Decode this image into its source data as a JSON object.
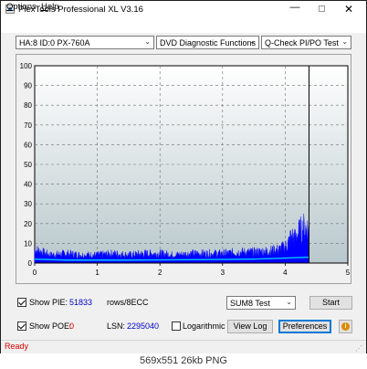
{
  "window": {
    "title": "PlexTools Professional XL V3.16",
    "minimize_glyph": "—",
    "close_glyph": "✕"
  },
  "menu": {
    "options_u": "O",
    "options_rest": "ptions",
    "help_u": "H",
    "help_rest": "elp"
  },
  "toolbar": {
    "drive": "HA:8 ID:0  PX-760A",
    "function": "DVD Diagnostic Functions",
    "test": "Q-Check  PI/PO Test",
    "arrow_glyph": "⌄"
  },
  "chart_data": {
    "type": "area",
    "x_ticks": [
      "0",
      "1",
      "2",
      "3",
      "4",
      "5"
    ],
    "y_ticks": [
      "100",
      "90",
      "80",
      "70",
      "60",
      "50",
      "40",
      "30",
      "20",
      "10",
      "0"
    ],
    "xlim": [
      0,
      5
    ],
    "ylim": [
      0,
      100
    ],
    "grid": true,
    "end_marker_x": 4.38,
    "series": [
      {
        "color": "#0000ff",
        "kind": "pie_bars",
        "x": [
          0,
          0.25,
          0.5,
          0.75,
          1.0,
          1.25,
          1.5,
          1.75,
          2.0,
          2.25,
          2.5,
          2.75,
          3.0,
          3.25,
          3.5,
          3.75,
          3.9,
          4.0,
          4.05,
          4.1,
          4.15,
          4.2,
          4.25,
          4.3,
          4.38
        ],
        "y": [
          10,
          6,
          7,
          6,
          6,
          7,
          6,
          7,
          7,
          6,
          7,
          7,
          7,
          8,
          8,
          9,
          10,
          12,
          15,
          20,
          18,
          22,
          24,
          26,
          25
        ]
      },
      {
        "color": "#00c8ff",
        "kind": "pie_average",
        "x": [
          0,
          0.5,
          1.0,
          1.5,
          2.0,
          2.5,
          3.0,
          3.5,
          4.0,
          4.38
        ],
        "y": [
          2,
          1.5,
          1.5,
          1.5,
          1.6,
          1.7,
          1.8,
          2.0,
          2.5,
          3
        ]
      }
    ]
  },
  "controls": {
    "show_pie_label": "Show PIE:",
    "show_pie_value": "51833",
    "rows_label": "rows/8ECC",
    "show_poe_label": "Show POE:",
    "show_poe_value": "0",
    "lsn_label": "LSN:",
    "lsn_value": "2295040",
    "logarithmic_label": "Logarithmic",
    "sum_select": "SUM8 Test",
    "start_label": "Start",
    "view_log_label": "View Log",
    "preferences_label": "Preferences",
    "info_glyph": "i"
  },
  "status": {
    "text": "Ready",
    "grip": "⋰"
  },
  "footer": {
    "text": "569x551  26kb  PNG"
  }
}
